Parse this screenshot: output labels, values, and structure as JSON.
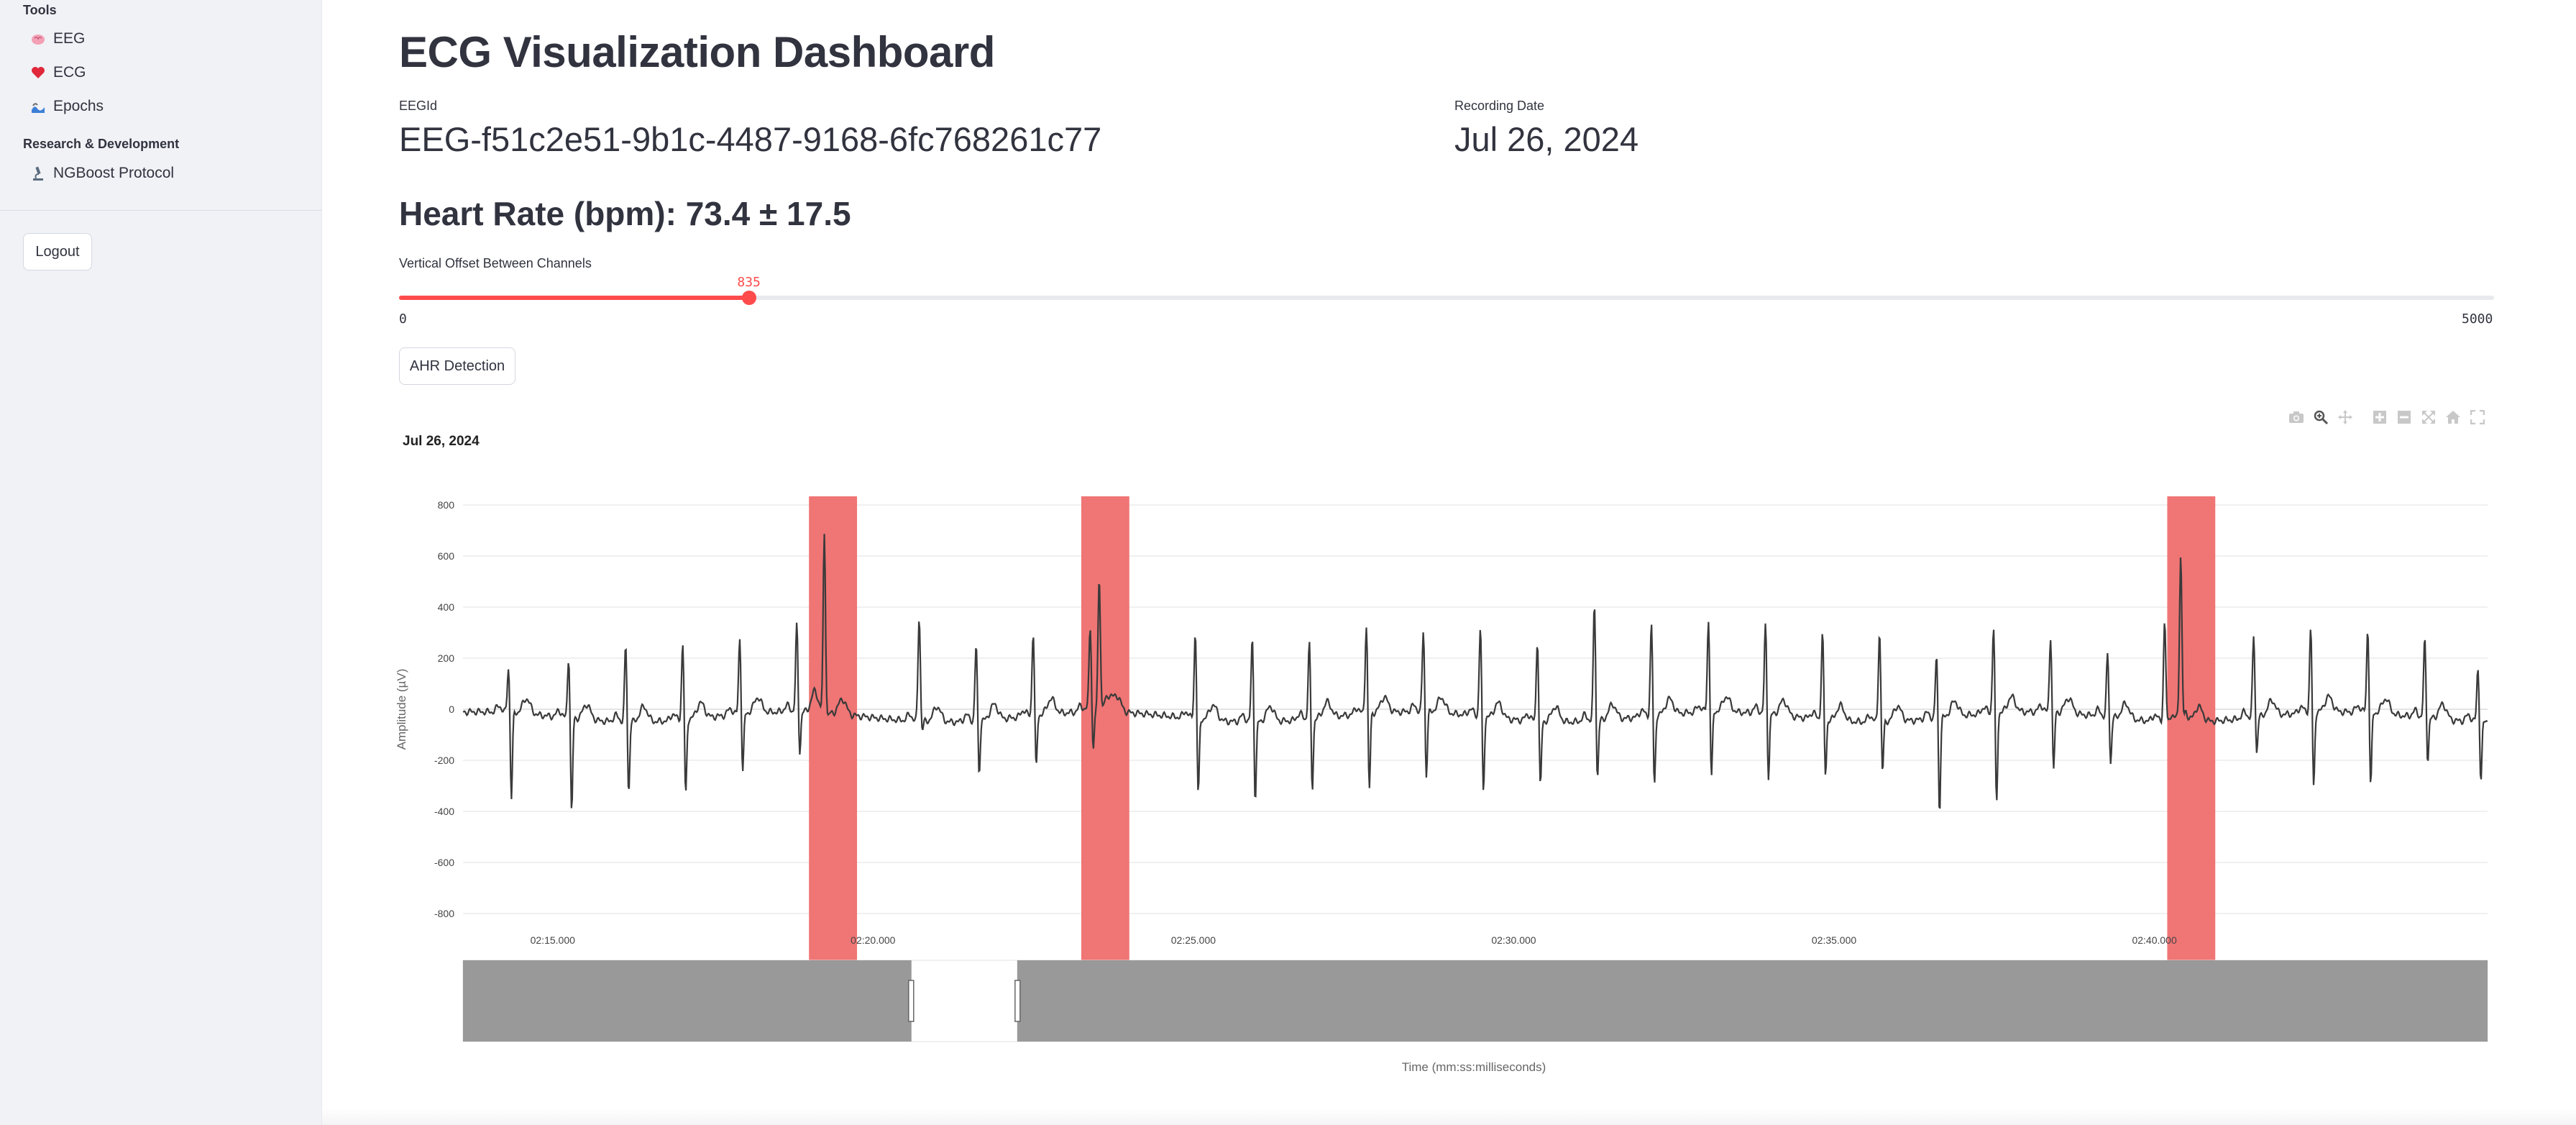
{
  "sidebar": {
    "tools_heading": "Tools",
    "tools": [
      {
        "label": "EEG",
        "icon": "brain-icon"
      },
      {
        "label": "ECG",
        "icon": "heart-icon"
      },
      {
        "label": "Epochs",
        "icon": "waves-icon"
      }
    ],
    "research_heading": "Research & Development",
    "research": [
      {
        "label": "NGBoost Protocol",
        "icon": "microscope-icon"
      }
    ],
    "logout_label": "Logout"
  },
  "main": {
    "title": "ECG Visualization Dashboard",
    "eegid_label": "EEGId",
    "eegid_value": "EEG-f51c2e51-9b1c-4487-9168-6fc768261c77",
    "date_label": "Recording Date",
    "date_value": "Jul 26, 2024",
    "heart_rate": "Heart Rate (bpm): 73.4 ± 17.5",
    "slider": {
      "label": "Vertical Offset Between Channels",
      "min": 0,
      "max": 5000,
      "value": 835,
      "min_label": "0",
      "max_label": "5000",
      "value_label": "835"
    },
    "ahr_button": "AHR Detection"
  },
  "colors": {
    "accent": "#ff4b4b",
    "highlight": "#f07575",
    "trace": "#3a3a3a",
    "sidebar_bg": "#f0f2f6",
    "rangeslider": "#999999"
  },
  "modebar_icons": [
    "camera-icon",
    "zoom-icon",
    "pan-icon",
    "zoom-in-icon",
    "zoom-out-icon",
    "autoscale-icon",
    "reset-axes-icon",
    "fullscreen-icon"
  ],
  "chart_data": {
    "type": "line",
    "title": "Jul 26, 2024",
    "xlabel": "Time (mm:ss:milliseconds)",
    "ylabel": "Amplitude (µV)",
    "ylim": [
      -800,
      800
    ],
    "yticks": [
      800,
      600,
      400,
      200,
      0,
      -200,
      -400,
      -600,
      -800
    ],
    "xlim_seconds": [
      793.6,
      825.2
    ],
    "xticks": [
      {
        "t": 795,
        "label": "02:15.000"
      },
      {
        "t": 800,
        "label": "02:20.000"
      },
      {
        "t": 805,
        "label": "02:25.000"
      },
      {
        "t": 810,
        "label": "02:30.000"
      },
      {
        "t": 815,
        "label": "02:35.000"
      },
      {
        "t": 820,
        "label": "02:40.000"
      }
    ],
    "highlight_regions": [
      [
        799.0,
        799.75
      ],
      [
        803.25,
        804.0
      ],
      [
        820.2,
        820.95
      ]
    ],
    "rangeslider_gap": [
      800.6,
      802.25
    ],
    "series": [
      {
        "beats": [
          {
            "t": 794.31,
            "r": 180,
            "s": -400
          },
          {
            "t": 795.25,
            "r": 240,
            "s": -440
          },
          {
            "t": 796.14,
            "r": 300,
            "s": -350
          },
          {
            "t": 797.03,
            "r": 300,
            "s": -370
          },
          {
            "t": 797.92,
            "r": 300,
            "s": -300
          },
          {
            "t": 798.81,
            "r": 340,
            "s": -230
          },
          {
            "t": 799.24,
            "r": 700,
            "s": -80
          },
          {
            "t": 800.72,
            "r": 410,
            "s": -100
          },
          {
            "t": 801.61,
            "r": 300,
            "s": -280
          },
          {
            "t": 802.5,
            "r": 330,
            "s": -280
          },
          {
            "t": 803.39,
            "r": 310,
            "s": -230
          },
          {
            "t": 803.53,
            "r": 530,
            "s": -70
          },
          {
            "t": 805.03,
            "r": 340,
            "s": -370
          },
          {
            "t": 805.92,
            "r": 330,
            "s": -380
          },
          {
            "t": 806.81,
            "r": 300,
            "s": -350
          },
          {
            "t": 807.7,
            "r": 350,
            "s": -370
          },
          {
            "t": 808.59,
            "r": 320,
            "s": -320
          },
          {
            "t": 809.48,
            "r": 350,
            "s": -370
          },
          {
            "t": 810.37,
            "r": 320,
            "s": -330
          },
          {
            "t": 811.26,
            "r": 460,
            "s": -300
          },
          {
            "t": 812.15,
            "r": 360,
            "s": -350
          },
          {
            "t": 813.04,
            "r": 360,
            "s": -330
          },
          {
            "t": 813.93,
            "r": 350,
            "s": -320
          },
          {
            "t": 814.82,
            "r": 340,
            "s": -290
          },
          {
            "t": 815.71,
            "r": 360,
            "s": -270
          },
          {
            "t": 816.6,
            "r": 250,
            "s": -440
          },
          {
            "t": 817.49,
            "r": 340,
            "s": -430
          },
          {
            "t": 818.38,
            "r": 300,
            "s": -300
          },
          {
            "t": 819.27,
            "r": 250,
            "s": -250
          },
          {
            "t": 820.16,
            "r": 390,
            "s": -80
          },
          {
            "t": 820.41,
            "r": 600,
            "s": -100
          },
          {
            "t": 821.55,
            "r": 320,
            "s": -210
          },
          {
            "t": 822.44,
            "r": 330,
            "s": -370
          },
          {
            "t": 823.33,
            "r": 330,
            "s": -360
          },
          {
            "t": 824.22,
            "r": 310,
            "s": -240
          },
          {
            "t": 825.05,
            "r": 210,
            "s": -300
          }
        ]
      }
    ]
  }
}
